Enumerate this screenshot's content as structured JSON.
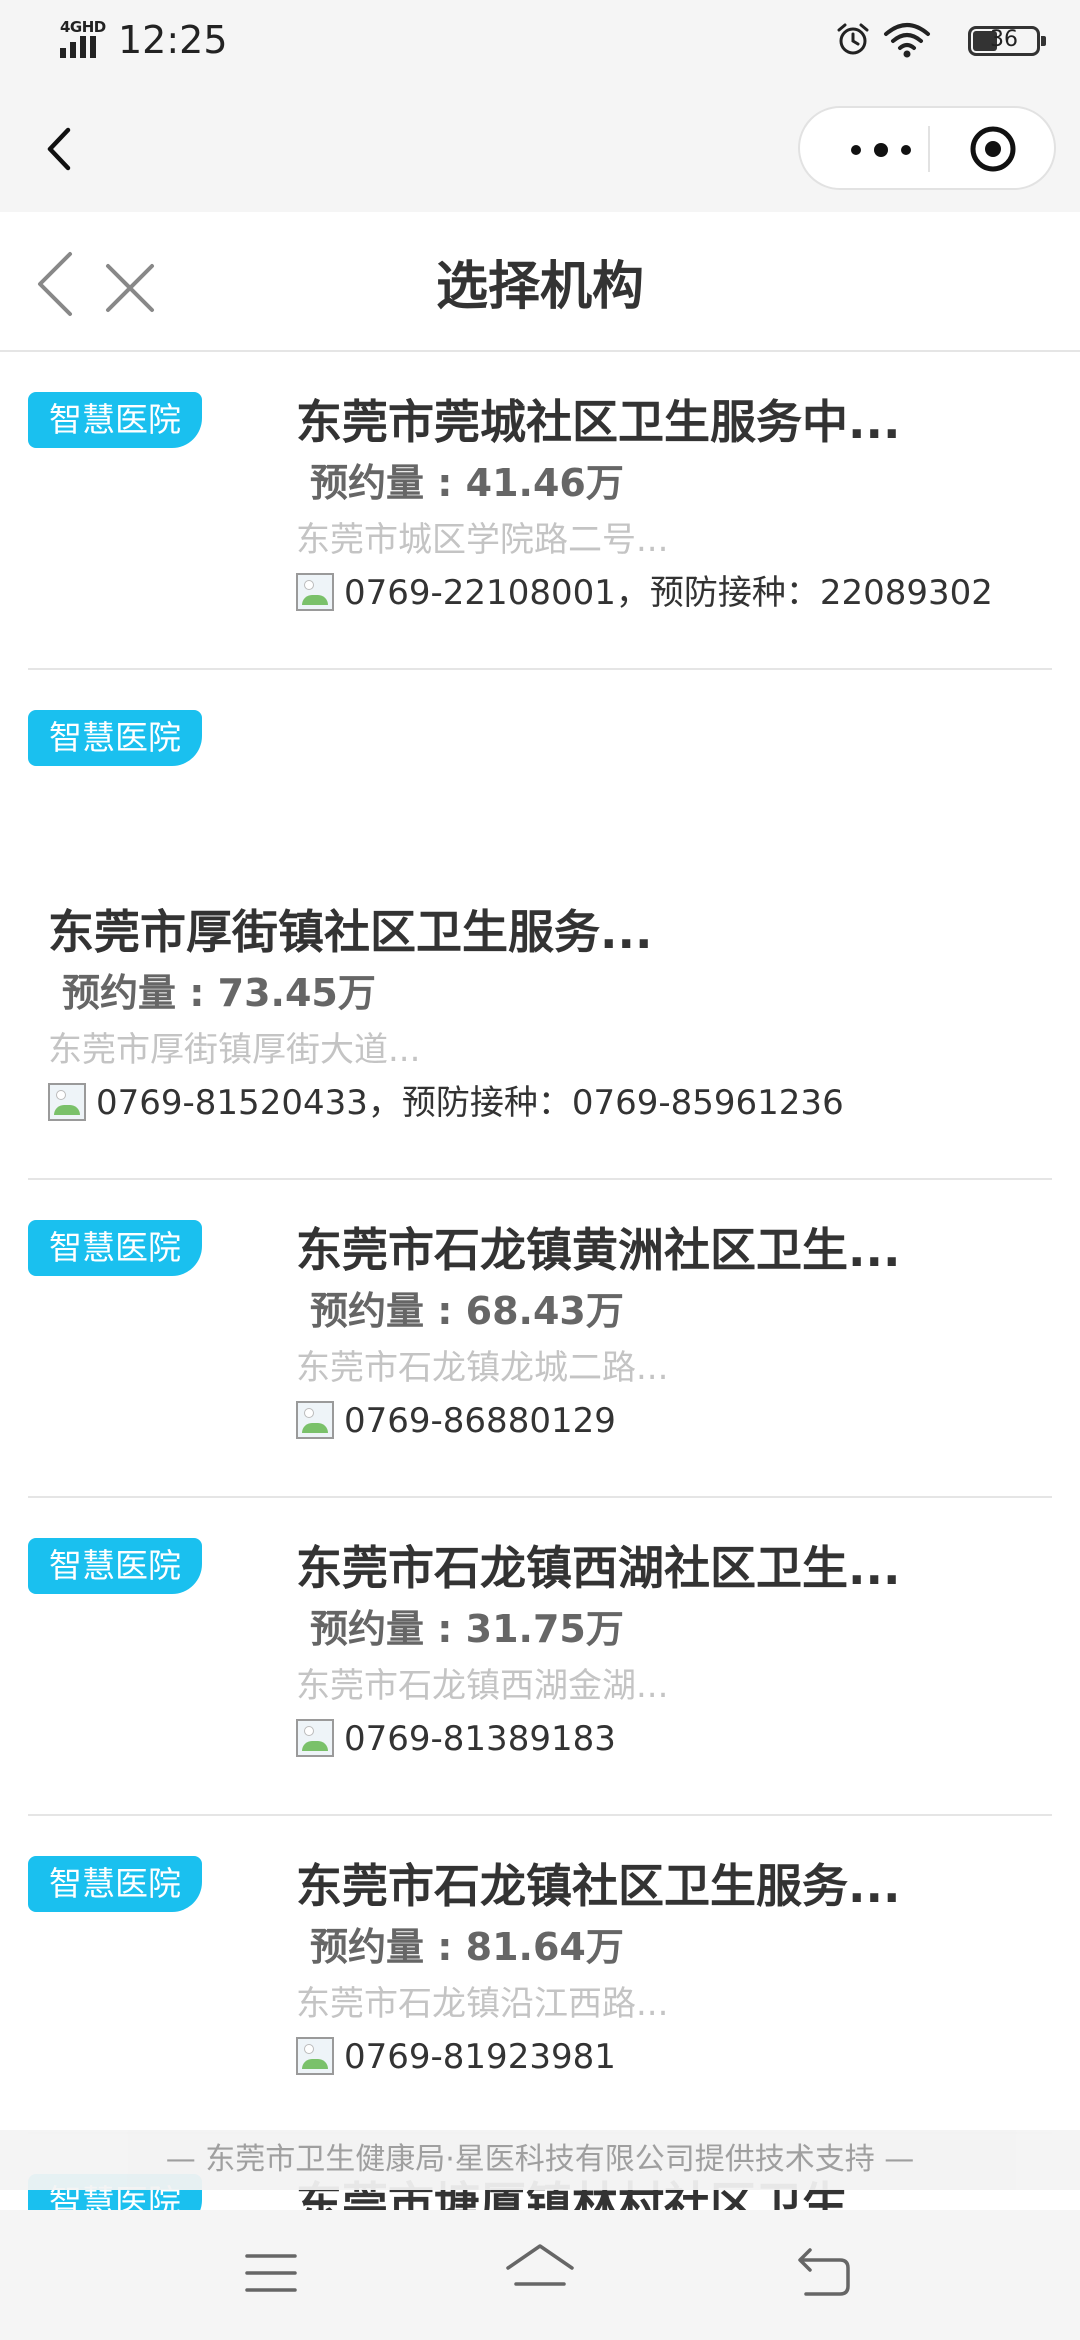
{
  "status_bar": {
    "network": "4GHD",
    "time": "12:25",
    "battery": "36"
  },
  "header": {
    "title": "选择机构"
  },
  "institutions": [
    {
      "badge": "智慧医院",
      "name": "东莞市莞城社区卫生服务中...",
      "count_label": "预约量",
      "count_value": "41.46万",
      "address": "东莞市城区学院路二号...",
      "phone": "0769-22108001，预防接种：22089302"
    },
    {
      "badge": "智慧医院",
      "name": "东莞市厚街镇社区卫生服务...",
      "count_label": "预约量",
      "count_value": "73.45万",
      "address": "东莞市厚街镇厚街大道...",
      "phone": "0769-81520433，预防接种：0769-85961236"
    },
    {
      "badge": "智慧医院",
      "name": "东莞市石龙镇黄洲社区卫生...",
      "count_label": "预约量",
      "count_value": "68.43万",
      "address": "东莞市石龙镇龙城二路...",
      "phone": "0769-86880129"
    },
    {
      "badge": "智慧医院",
      "name": "东莞市石龙镇西湖社区卫生...",
      "count_label": "预约量",
      "count_value": "31.75万",
      "address": "东莞市石龙镇西湖金湖...",
      "phone": "0769-81389183"
    },
    {
      "badge": "智慧医院",
      "name": "东莞市石龙镇社区卫生服务...",
      "count_label": "预约量",
      "count_value": "81.64万",
      "address": "东莞市石龙镇沿江西路...",
      "phone": "0769-81923981"
    },
    {
      "badge": "智慧医院",
      "name": "东莞市塘厦镇林村社区卫生..."
    }
  ],
  "footer": {
    "support_text": "— 东莞市卫生健康局·星医科技有限公司提供技术支持 —"
  },
  "icons": {
    "back": "chevron-left-icon",
    "close": "close-icon",
    "more": "more-dots-icon",
    "target": "target-icon",
    "phone": "phone-image-icon",
    "menu": "menu-icon",
    "home": "home-icon",
    "return": "return-icon"
  },
  "colors": {
    "badge": "#1ac0ef",
    "title": "#333333",
    "address": "#c4c4c4",
    "count": "#666666"
  }
}
